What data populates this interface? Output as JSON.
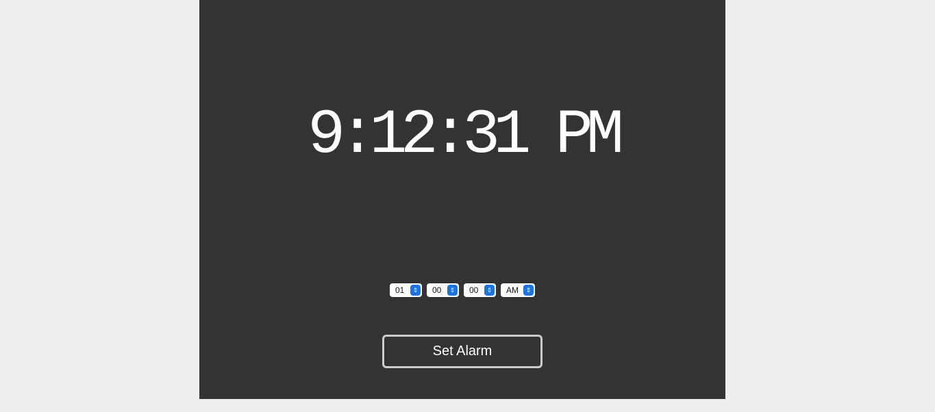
{
  "clock": {
    "time": "9:12:31 PM"
  },
  "alarm": {
    "hour": "01",
    "minute": "00",
    "second": "00",
    "period": "AM",
    "set_label": "Set Alarm"
  },
  "colors": {
    "panel": "#333333",
    "background": "#eeeeee",
    "accent": "#1a73e8"
  }
}
